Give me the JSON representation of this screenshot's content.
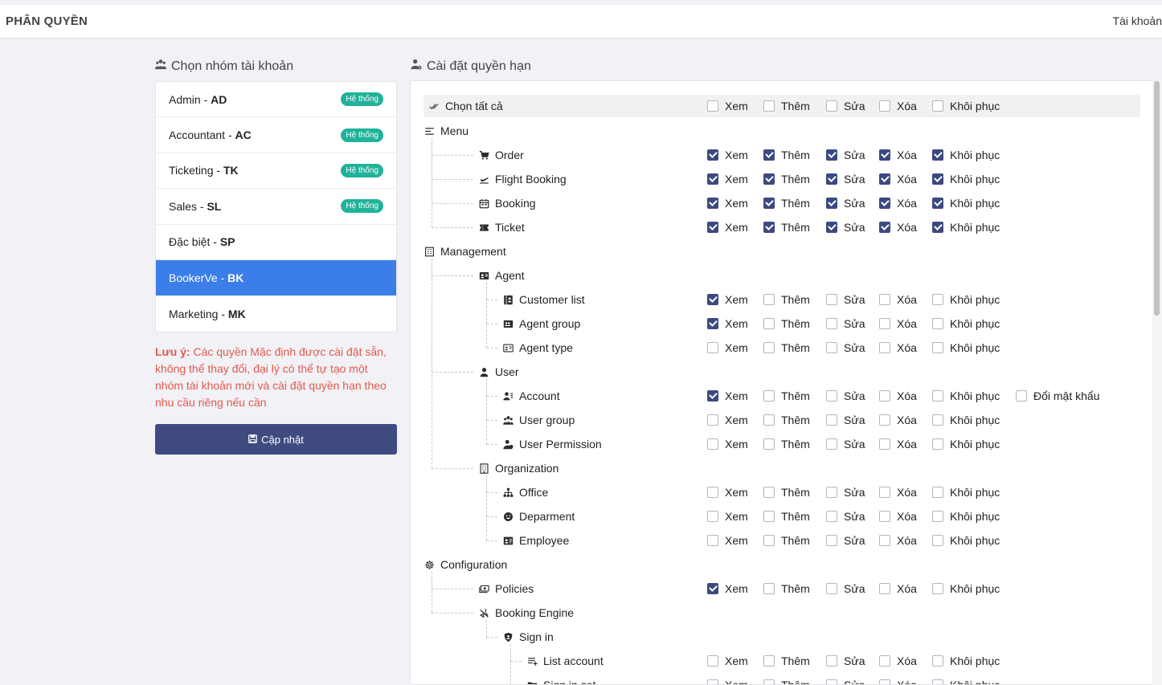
{
  "header": {
    "title": "PHÂN QUYỀN",
    "account": "Tài khoản"
  },
  "groups_section": {
    "title": "Chọn nhóm tài khoản"
  },
  "permissions_section": {
    "title": "Cài đặt quyền hạn"
  },
  "groups": [
    {
      "name": "Admin - ",
      "code": "AD",
      "badge": "Hệ thống",
      "active": false
    },
    {
      "name": "Accountant - ",
      "code": "AC",
      "badge": "Hệ thống",
      "active": false
    },
    {
      "name": "Ticketing - ",
      "code": "TK",
      "badge": "Hệ thống",
      "active": false
    },
    {
      "name": "Sales - ",
      "code": "SL",
      "badge": "Hệ thống",
      "active": false
    },
    {
      "name": "Đặc biệt - ",
      "code": "SP",
      "badge": "",
      "active": false
    },
    {
      "name": "BookerVe - ",
      "code": "BK",
      "badge": "",
      "active": true
    },
    {
      "name": "Marketing - ",
      "code": "MK",
      "badge": "",
      "active": false
    }
  ],
  "note": {
    "label": "Lưu ý:",
    "text": " Các quyền Mặc định được cài đặt sẵn, không thể thay đổi, đại lý có thể tự tạo một nhóm tài khoản mới và cài đặt quyền hạn theo nhu cầu riêng nếu cần"
  },
  "update_button": {
    "label": "Cập nhật",
    "icon": "save-icon"
  },
  "perm_labels": [
    "Xem",
    "Thêm",
    "Sửa",
    "Xóa",
    "Khôi phục"
  ],
  "colors": {
    "accent": "#3b7de9",
    "primary_button": "#3f4b80",
    "badge": "#20b29a",
    "note": "#e25a4c",
    "checkbox_checked": "#3d4a7f"
  },
  "tree": [
    {
      "label": "Chọn tất cả",
      "level": 0,
      "icon": "double-check-icon",
      "perms": [
        false,
        false,
        false,
        false,
        false
      ],
      "select_all": true
    },
    {
      "label": "Menu",
      "level": 0,
      "icon": "menu-icon"
    },
    {
      "label": "Order",
      "level": 1,
      "icon": "cart-icon",
      "perms": [
        true,
        true,
        true,
        true,
        true
      ]
    },
    {
      "label": "Flight Booking",
      "level": 1,
      "icon": "plane-depart-icon",
      "perms": [
        true,
        true,
        true,
        true,
        true
      ]
    },
    {
      "label": "Booking",
      "level": 1,
      "icon": "calendar-icon",
      "perms": [
        true,
        true,
        true,
        true,
        true
      ]
    },
    {
      "label": "Ticket",
      "level": 1,
      "icon": "ticket-icon",
      "perms": [
        true,
        true,
        true,
        true,
        true
      ]
    },
    {
      "label": "Management",
      "level": 0,
      "icon": "building-icon"
    },
    {
      "label": "Agent",
      "level": 1,
      "icon": "id-card-icon"
    },
    {
      "label": "Customer list",
      "level": 2,
      "icon": "contact-book-icon",
      "perms": [
        true,
        false,
        false,
        false,
        false
      ]
    },
    {
      "label": "Agent group",
      "level": 2,
      "icon": "group-card-icon",
      "perms": [
        true,
        false,
        false,
        false,
        false
      ]
    },
    {
      "label": "Agent type",
      "level": 2,
      "icon": "type-card-icon",
      "perms": [
        false,
        false,
        false,
        false,
        false
      ]
    },
    {
      "label": "User",
      "level": 1,
      "icon": "user-icon"
    },
    {
      "label": "Account",
      "level": 2,
      "icon": "user-list-icon",
      "perms": [
        true,
        false,
        false,
        false,
        false
      ],
      "extra": {
        "label": "Đổi mật khẩu",
        "checked": false
      }
    },
    {
      "label": "User group",
      "level": 2,
      "icon": "users-icon",
      "perms": [
        false,
        false,
        false,
        false,
        false
      ]
    },
    {
      "label": "User Permission",
      "level": 2,
      "icon": "user-shield-icon",
      "perms": [
        false,
        false,
        false,
        false,
        false
      ]
    },
    {
      "label": "Organization",
      "level": 1,
      "icon": "office-building-icon"
    },
    {
      "label": "Office",
      "level": 2,
      "icon": "sitemap-icon",
      "perms": [
        false,
        false,
        false,
        false,
        false
      ]
    },
    {
      "label": "Deparment",
      "level": 2,
      "icon": "face-icon",
      "perms": [
        false,
        false,
        false,
        false,
        false
      ]
    },
    {
      "label": "Employee",
      "level": 2,
      "icon": "badge-card-icon",
      "perms": [
        false,
        false,
        false,
        false,
        false
      ]
    },
    {
      "label": "Configuration",
      "level": 0,
      "icon": "gear-icon"
    },
    {
      "label": "Policies",
      "level": 1,
      "icon": "money-icon",
      "perms": [
        true,
        false,
        false,
        false,
        false
      ]
    },
    {
      "label": "Booking Engine",
      "level": 1,
      "icon": "plane-off-icon"
    },
    {
      "label": "Sign in",
      "level": 2,
      "icon": "shield-icon"
    },
    {
      "label": "List account",
      "level": 3,
      "icon": "list-add-icon",
      "perms": [
        false,
        false,
        false,
        false,
        false
      ]
    },
    {
      "label": "Sign in set",
      "level": 3,
      "icon": "folder-icon",
      "perms": [
        false,
        false,
        false,
        false,
        false
      ]
    }
  ]
}
